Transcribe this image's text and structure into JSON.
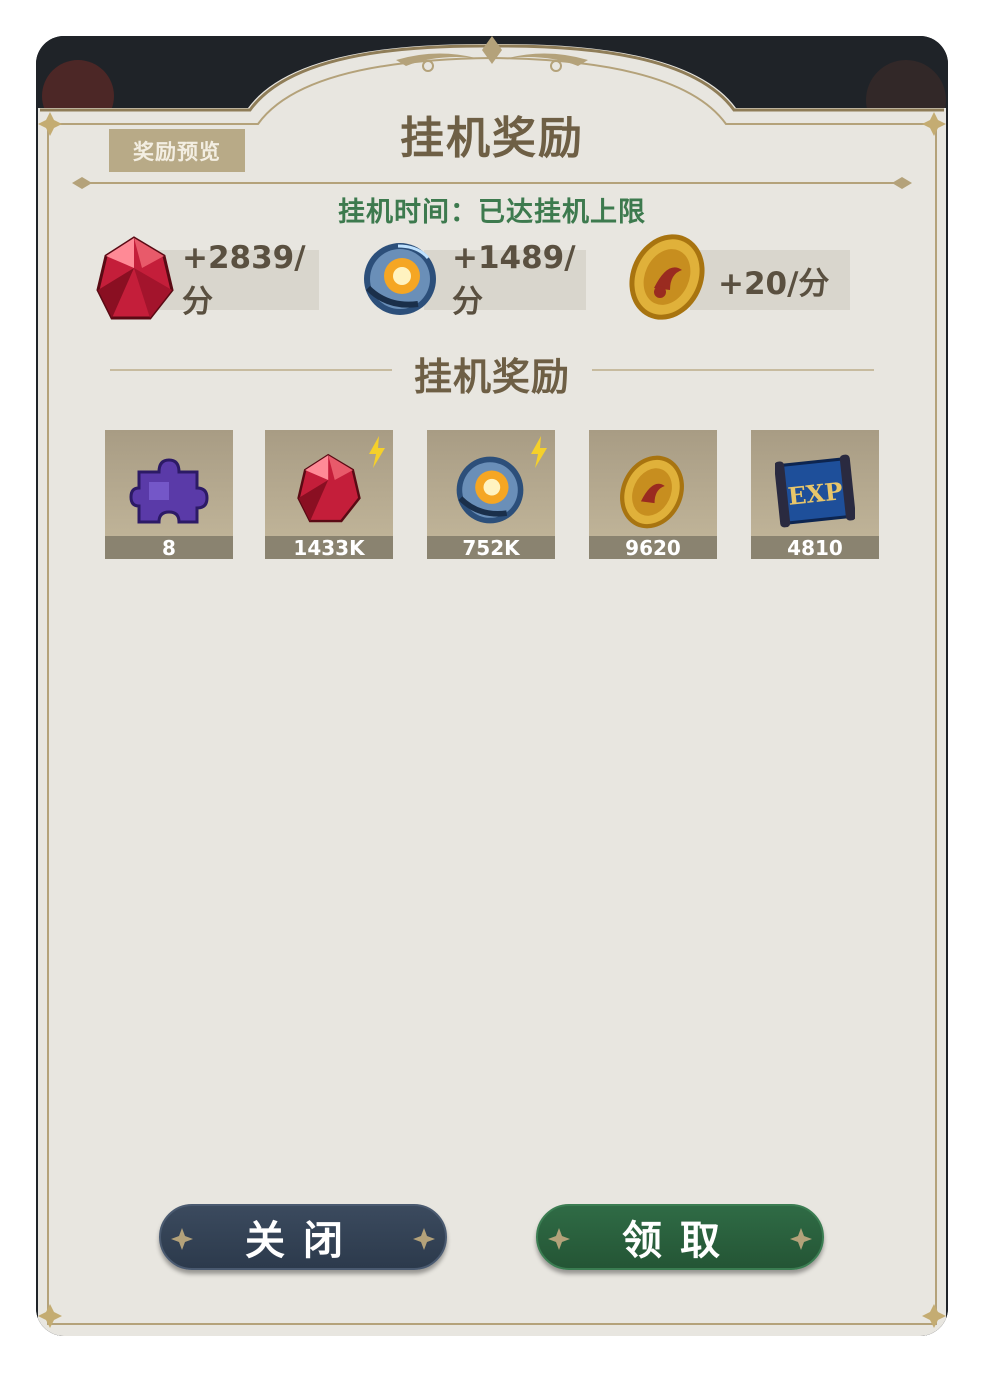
{
  "window": {
    "title": "挂机奖励",
    "preview_button": "奖励预览",
    "idle_status": "挂机时间：已达挂机上限"
  },
  "rates": [
    {
      "icon": "red-gem-icon",
      "text": "+2839/分"
    },
    {
      "icon": "energy-orb-icon",
      "text": "+1489/分"
    },
    {
      "icon": "gold-coin-icon",
      "text": "+20/分"
    }
  ],
  "rewards_section": {
    "title": "挂机奖励",
    "items": [
      {
        "icon": "purple-puzzle-icon",
        "quantity": "8",
        "boosted": false
      },
      {
        "icon": "red-gem-icon",
        "quantity": "1433K",
        "boosted": true
      },
      {
        "icon": "energy-orb-icon",
        "quantity": "752K",
        "boosted": true
      },
      {
        "icon": "gold-coin-icon",
        "quantity": "9620",
        "boosted": false
      },
      {
        "icon": "exp-scroll-icon",
        "quantity": "4810",
        "boosted": false
      }
    ],
    "exp_label": "EXP"
  },
  "buttons": {
    "close": "关闭",
    "claim": "领取"
  },
  "colors": {
    "panel": "#e8e6e0",
    "title_text": "#6e5f45",
    "status_green": "#3d7a4e",
    "close_button": "#33425a",
    "claim_button": "#2a6140",
    "gold_trim": "#b4a27a"
  }
}
